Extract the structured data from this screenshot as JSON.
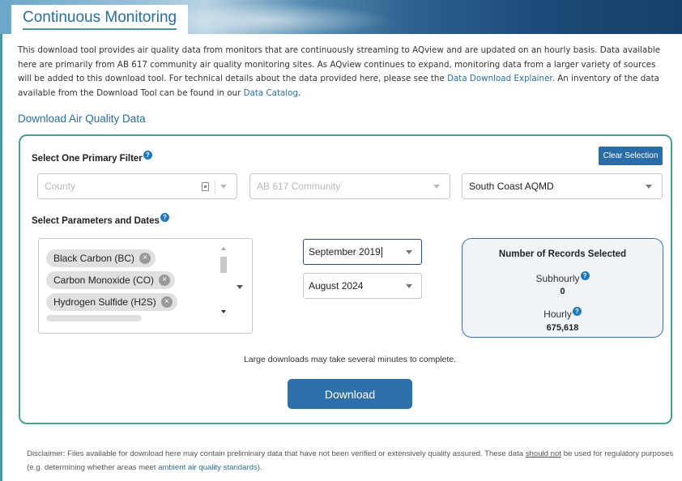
{
  "header": {
    "title": "Continuous Monitoring"
  },
  "intro": {
    "text_1": "This download tool provides air quality data from monitors that are continuously streaming to AQview and are updated on an hourly basis. Data available here are primarily from AB 617 community air quality monitoring sites. As AQview continues to expand, monitoring data from a larger variety of sources will be added to this download tool. For technical details about the data provided here, please see the ",
    "link_explainer": "Data Download Explainer",
    "text_2": ". An inventory of the data available from the Download Tool can be found in our ",
    "link_catalog": "Data Catalog",
    "text_3": "."
  },
  "section_title": "Download Air Quality Data",
  "filter": {
    "label": "Select One Primary Filter",
    "clear_label": "Clear Selection",
    "county_placeholder": "County",
    "community_placeholder": "AB 617 Community",
    "district_value": "South Coast AQMD"
  },
  "params": {
    "label": "Select Parameters and Dates",
    "chips": [
      "Black Carbon (BC)",
      "Carbon Monoxide (CO)",
      "Hydrogen Sulfide (H2S)"
    ],
    "start_date": "September 2019",
    "end_date": "August 2024"
  },
  "records": {
    "title": "Number of Records Selected",
    "subhourly_label": "Subhourly",
    "subhourly_value": "0",
    "hourly_label": "Hourly",
    "hourly_value": "675,618"
  },
  "note": "Large downloads may take several minutes to complete.",
  "download_label": "Download",
  "help_icon": "?",
  "chip_remove_icon": "×",
  "disclaimer": {
    "text_1": "Disclaimer: Files available for download here may contain preliminary data that have not been verified or extensively quality assured. These data ",
    "underlined": "should not",
    "text_2": " be used for regulatory purposes (e.g. determining whether areas meet ",
    "link": "ambient air quality standards",
    "text_3": ")."
  },
  "colors": {
    "accent": "#2a6f9a",
    "panel_border": "#4a9f92",
    "button": "#2e70aa",
    "help_icon": "#1e78bf"
  }
}
